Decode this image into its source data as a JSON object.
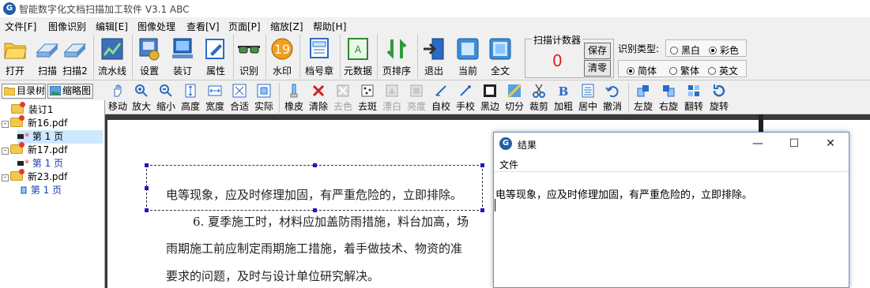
{
  "window": {
    "title": "智能数字化文档扫描加工软件 V3.1 ABC"
  },
  "menubar": [
    {
      "label": "文件[F]"
    },
    {
      "label": "图像识别"
    },
    {
      "label": "编辑[E]"
    },
    {
      "label": "图像处理"
    },
    {
      "label": "查看[V]"
    },
    {
      "label": "页面[P]"
    },
    {
      "label": "缩放[Z]"
    },
    {
      "label": "帮助[H]"
    }
  ],
  "toolbar": {
    "buttons": [
      {
        "label": "打开",
        "icon": "open-folder-icon"
      },
      {
        "label": "扫描",
        "icon": "scanner-icon"
      },
      {
        "label": "扫描2",
        "icon": "scanner2-icon"
      },
      {
        "label": "流水线",
        "icon": "pipeline-icon"
      },
      {
        "label": "设置",
        "icon": "settings-icon"
      },
      {
        "label": "装订",
        "icon": "bind-icon"
      },
      {
        "label": "属性",
        "icon": "properties-icon"
      },
      {
        "label": "识别",
        "icon": "recognize-glasses-icon"
      },
      {
        "label": "水印",
        "icon": "watermark-icon"
      },
      {
        "label": "档号章",
        "icon": "archive-stamp-icon"
      },
      {
        "label": "元数据",
        "icon": "metadata-icon"
      },
      {
        "label": "页排序",
        "icon": "page-sort-icon"
      },
      {
        "label": "退出",
        "icon": "exit-icon"
      },
      {
        "label": "当前",
        "icon": "current-icon"
      },
      {
        "label": "全文",
        "icon": "fulltext-icon"
      }
    ],
    "counter": {
      "caption": "扫描计数器",
      "value": "0",
      "save_label": "保存",
      "clear_label": "清零"
    },
    "ocr": {
      "type_label": "识别类型:",
      "color_options": [
        {
          "label": "黑白",
          "checked": false
        },
        {
          "label": "彩色",
          "checked": true
        }
      ],
      "script_options": [
        {
          "label": "简体",
          "checked": true
        },
        {
          "label": "繁体",
          "checked": false
        },
        {
          "label": "英文",
          "checked": false
        }
      ]
    }
  },
  "left_panel": {
    "tabs": [
      {
        "label": "目录树"
      },
      {
        "label": "缩略图"
      }
    ],
    "tree": [
      {
        "label": "装订1",
        "kind": "folder",
        "level": 0
      },
      {
        "label": "新16.pdf",
        "kind": "folder",
        "level": 0,
        "expand": "-"
      },
      {
        "label": "第 1 页",
        "kind": "page",
        "level": 1,
        "selected": true
      },
      {
        "label": "新17.pdf",
        "kind": "folder",
        "level": 0,
        "expand": "-"
      },
      {
        "label": "第 1 页",
        "kind": "page",
        "level": 1,
        "selected": false
      },
      {
        "label": "新23.pdf",
        "kind": "folder",
        "level": 0,
        "expand": "-"
      },
      {
        "label": "第 1 页",
        "kind": "page",
        "level": 1,
        "selected": false
      }
    ]
  },
  "edit_toolbar": [
    {
      "label": "移动",
      "icon": "hand-move-icon",
      "enabled": true
    },
    {
      "label": "放大",
      "icon": "zoom-in-icon",
      "enabled": true
    },
    {
      "label": "缩小",
      "icon": "zoom-out-icon",
      "enabled": true
    },
    {
      "label": "高度",
      "icon": "fit-height-icon",
      "enabled": true
    },
    {
      "label": "宽度",
      "icon": "fit-width-icon",
      "enabled": true
    },
    {
      "label": "合适",
      "icon": "fit-best-icon",
      "enabled": true
    },
    {
      "label": "实际",
      "icon": "actual-size-icon",
      "enabled": true
    },
    {
      "label": "橡皮",
      "icon": "eraser-icon",
      "enabled": true
    },
    {
      "label": "清除",
      "icon": "clear-x-icon",
      "enabled": true
    },
    {
      "label": "去色",
      "icon": "decolor-icon",
      "enabled": false
    },
    {
      "label": "去斑",
      "icon": "despeckle-icon",
      "enabled": true
    },
    {
      "label": "漂白",
      "icon": "bleach-icon",
      "enabled": false
    },
    {
      "label": "亮度",
      "icon": "brightness-icon",
      "enabled": false
    },
    {
      "label": "自校",
      "icon": "auto-deskew-icon",
      "enabled": true
    },
    {
      "label": "手校",
      "icon": "manual-deskew-icon",
      "enabled": true
    },
    {
      "label": "黑边",
      "icon": "black-border-icon",
      "enabled": true
    },
    {
      "label": "切分",
      "icon": "split-icon",
      "enabled": true
    },
    {
      "label": "裁剪",
      "icon": "crop-scissors-icon",
      "enabled": true
    },
    {
      "label": "加粗",
      "icon": "bold-icon",
      "enabled": true
    },
    {
      "label": "居中",
      "icon": "center-icon",
      "enabled": true
    },
    {
      "label": "撤消",
      "icon": "undo-icon",
      "enabled": true
    },
    {
      "label": "左旋",
      "icon": "rotate-left-icon",
      "enabled": true
    },
    {
      "label": "右旋",
      "icon": "rotate-right-icon",
      "enabled": true
    },
    {
      "label": "翻转",
      "icon": "flip-icon",
      "enabled": true
    },
    {
      "label": "旋转",
      "icon": "rotate-icon",
      "enabled": true
    }
  ],
  "document": {
    "lines": [
      "电等现象，应及时修理加固，有严重危险的，立即排除。",
      "6. 夏季施工时，材料应加盖防雨措施，料台加高，场",
      "雨期施工前应制定雨期施工措施，着手做技术、物资的准",
      "要求的问题，及时与设计单位研究解决。"
    ]
  },
  "result_window": {
    "title": "结果",
    "menu_label": "文件",
    "text": "电等现象，应及时修理加固，有严重危险的，立即排除。",
    "controls": {
      "minimize": "—",
      "maximize": "☐",
      "close": "✕"
    }
  }
}
